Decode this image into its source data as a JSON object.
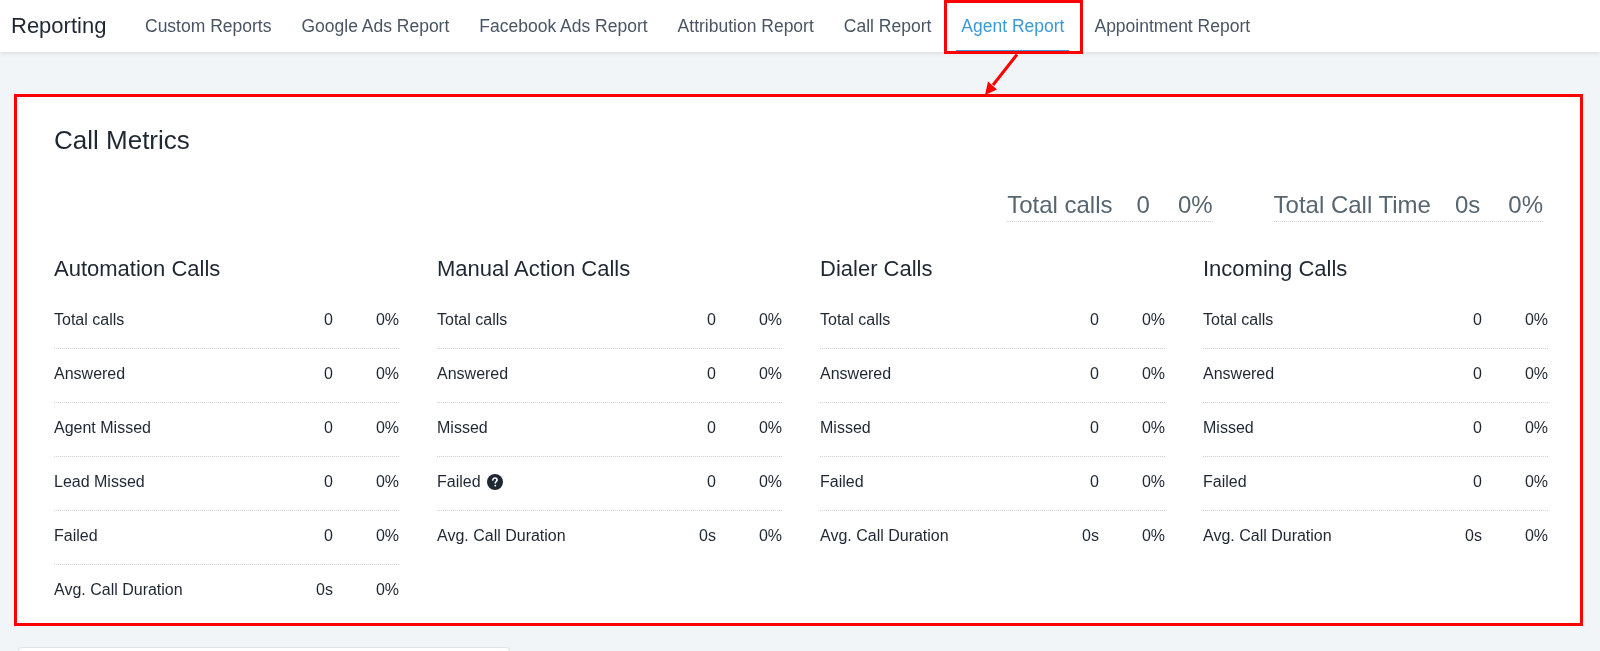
{
  "nav": {
    "title": "Reporting",
    "tabs": [
      {
        "label": "Custom Reports",
        "selected": false,
        "highlighted": false
      },
      {
        "label": "Google Ads Report",
        "selected": false,
        "highlighted": false
      },
      {
        "label": "Facebook Ads Report",
        "selected": false,
        "highlighted": false
      },
      {
        "label": "Attribution Report",
        "selected": false,
        "highlighted": false
      },
      {
        "label": "Call Report",
        "selected": false,
        "highlighted": false
      },
      {
        "label": "Agent Report",
        "selected": true,
        "highlighted": true
      },
      {
        "label": "Appointment Report",
        "selected": false,
        "highlighted": false
      }
    ]
  },
  "card": {
    "title": "Call Metrics",
    "highlighted": true,
    "totals": [
      {
        "label": "Total calls",
        "value": "0",
        "percent": "0%"
      },
      {
        "label": "Total Call Time",
        "value": "0s",
        "percent": "0%"
      }
    ],
    "sections": [
      {
        "title": "Automation Calls",
        "rows": [
          {
            "label": "Total calls",
            "value": "0",
            "percent": "0%",
            "help": false
          },
          {
            "label": "Answered",
            "value": "0",
            "percent": "0%",
            "help": false
          },
          {
            "label": "Agent Missed",
            "value": "0",
            "percent": "0%",
            "help": false
          },
          {
            "label": "Lead Missed",
            "value": "0",
            "percent": "0%",
            "help": false
          },
          {
            "label": "Failed",
            "value": "0",
            "percent": "0%",
            "help": false
          },
          {
            "label": "Avg. Call Duration",
            "value": "0s",
            "percent": "0%",
            "help": false
          }
        ]
      },
      {
        "title": "Manual Action Calls",
        "rows": [
          {
            "label": "Total calls",
            "value": "0",
            "percent": "0%",
            "help": false
          },
          {
            "label": "Answered",
            "value": "0",
            "percent": "0%",
            "help": false
          },
          {
            "label": "Missed",
            "value": "0",
            "percent": "0%",
            "help": false
          },
          {
            "label": "Failed",
            "value": "0",
            "percent": "0%",
            "help": true
          },
          {
            "label": "Avg. Call Duration",
            "value": "0s",
            "percent": "0%",
            "help": false
          }
        ]
      },
      {
        "title": "Dialer Calls",
        "rows": [
          {
            "label": "Total calls",
            "value": "0",
            "percent": "0%",
            "help": false
          },
          {
            "label": "Answered",
            "value": "0",
            "percent": "0%",
            "help": false
          },
          {
            "label": "Missed",
            "value": "0",
            "percent": "0%",
            "help": false
          },
          {
            "label": "Failed",
            "value": "0",
            "percent": "0%",
            "help": false
          },
          {
            "label": "Avg. Call Duration",
            "value": "0s",
            "percent": "0%",
            "help": false
          }
        ]
      },
      {
        "title": "Incoming Calls",
        "rows": [
          {
            "label": "Total calls",
            "value": "0",
            "percent": "0%",
            "help": false
          },
          {
            "label": "Answered",
            "value": "0",
            "percent": "0%",
            "help": false
          },
          {
            "label": "Missed",
            "value": "0",
            "percent": "0%",
            "help": false
          },
          {
            "label": "Failed",
            "value": "0",
            "percent": "0%",
            "help": false
          },
          {
            "label": "Avg. Call Duration",
            "value": "0s",
            "percent": "0%",
            "help": false
          }
        ]
      }
    ]
  }
}
